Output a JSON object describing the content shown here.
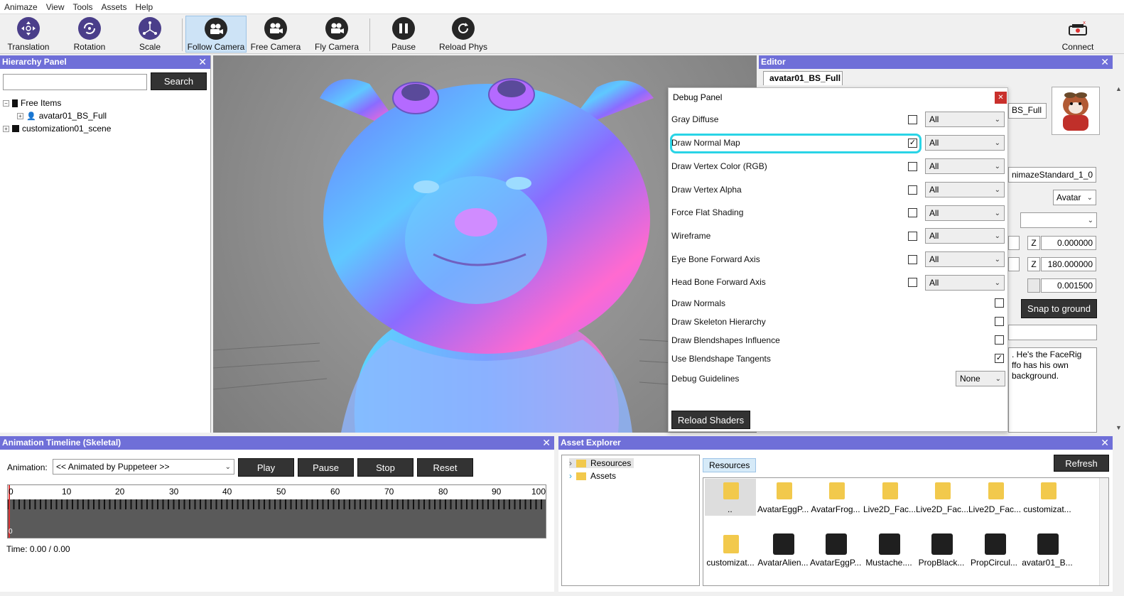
{
  "menu": [
    "Animaze",
    "View",
    "Tools",
    "Assets",
    "Help"
  ],
  "toolbar": {
    "tools": [
      {
        "label": "Translation",
        "icon": "translation-icon"
      },
      {
        "label": "Rotation",
        "icon": "rotation-icon"
      },
      {
        "label": "Scale",
        "icon": "scale-icon"
      },
      {
        "label": "Follow Camera",
        "icon": "camera-icon"
      },
      {
        "label": "Free Camera",
        "icon": "camera-icon"
      },
      {
        "label": "Fly Camera",
        "icon": "camera-icon"
      },
      {
        "label": "Pause",
        "icon": "pause-icon"
      },
      {
        "label": "Reload Phys",
        "icon": "reload-icon"
      }
    ],
    "connect": "Connect"
  },
  "hierarchy": {
    "title": "Hierarchy Panel",
    "search_button": "Search",
    "search_value": "",
    "items": [
      "Free Items",
      "avatar01_BS_Full",
      "customization01_scene"
    ]
  },
  "editor": {
    "title": "Editor",
    "tab": "avatar01_BS_Full",
    "name_field": "BS_Full",
    "shader": "nimazeStandard_1_0",
    "type": "Avatar",
    "z_label": "Z",
    "z1": "0.000000",
    "z2": "180.000000",
    "scale": "0.001500",
    "snap_button": "Snap to ground",
    "description": [
      ". He's the FaceRig",
      "ffo has his own",
      "background."
    ]
  },
  "debug": {
    "title": "Debug Panel",
    "rows": [
      {
        "label": "Gray Diffuse",
        "checked": false,
        "select": "All"
      },
      {
        "label": "Draw Normal Map",
        "checked": true,
        "select": "All"
      },
      {
        "label": "Draw Vertex Color (RGB)",
        "checked": false,
        "select": "All"
      },
      {
        "label": "Draw Vertex Alpha",
        "checked": false,
        "select": "All"
      },
      {
        "label": "Force Flat Shading",
        "checked": false,
        "select": "All"
      },
      {
        "label": "Wireframe",
        "checked": false,
        "select": "All"
      },
      {
        "label": "Eye Bone Forward Axis",
        "checked": false,
        "select": "All"
      },
      {
        "label": "Head Bone Forward Axis",
        "checked": false,
        "select": "All"
      }
    ],
    "toggles": [
      {
        "label": "Draw Normals",
        "checked": false
      },
      {
        "label": "Draw Skeleton Hierarchy",
        "checked": false
      },
      {
        "label": "Draw Blendshapes Influence",
        "checked": false
      },
      {
        "label": "Use Blendshape Tangents",
        "checked": true
      }
    ],
    "guidelines_label": "Debug Guidelines",
    "guidelines_value": "None",
    "reload_button": "Reload Shaders"
  },
  "animation": {
    "title": "Animation Timeline (Skeletal)",
    "label": "Animation:",
    "value": "<< Animated by Puppeteer >>",
    "buttons": [
      "Play",
      "Pause",
      "Stop",
      "Reset"
    ],
    "ticks": [
      "0",
      "10",
      "20",
      "30",
      "40",
      "50",
      "60",
      "70",
      "80",
      "90",
      "100"
    ],
    "time": "Time: 0.00 / 0.00"
  },
  "assets": {
    "title": "Asset Explorer",
    "tree": [
      "Resources",
      "Assets"
    ],
    "breadcrumb": "Resources",
    "refresh": "Refresh",
    "row1": [
      "..",
      "AvatarEggP...",
      "AvatarFrog...",
      "Live2D_Fac...",
      "Live2D_Fac...",
      "Live2D_Fac...",
      "customizat..."
    ],
    "row2": [
      "customizat...",
      "AvatarAlien...",
      "AvatarEggP...",
      "Mustache....",
      "PropBlack...",
      "PropCircul...",
      "avatar01_B..."
    ]
  }
}
